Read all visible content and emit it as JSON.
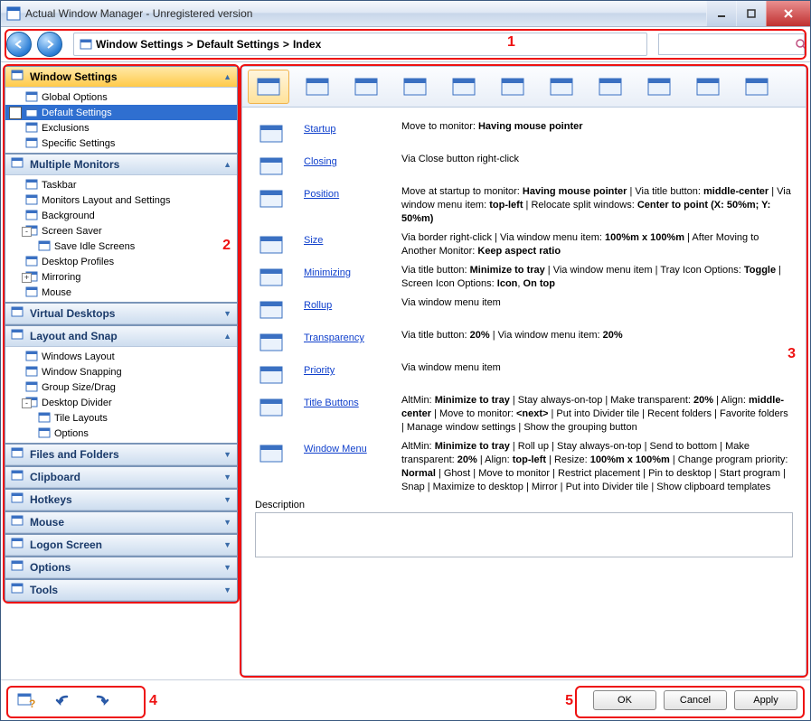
{
  "title": "Actual Window Manager - Unregistered version",
  "breadcrumb": [
    "Window Settings",
    "Default Settings",
    "Index"
  ],
  "search": {
    "placeholder": ""
  },
  "annotations": {
    "n1": "1",
    "n2": "2",
    "n3": "3",
    "n4": "4",
    "n5": "5"
  },
  "side": [
    {
      "hdr": "Window Settings",
      "sel": true,
      "open": true,
      "items": [
        {
          "t": "Global Options"
        },
        {
          "t": "Default Settings",
          "sel": true,
          "check": true
        },
        {
          "t": "Exclusions"
        },
        {
          "t": "Specific Settings"
        }
      ]
    },
    {
      "hdr": "Multiple Monitors",
      "open": true,
      "items": [
        {
          "t": "Taskbar"
        },
        {
          "t": "Monitors Layout and Settings"
        },
        {
          "t": "Background"
        },
        {
          "t": "Screen Saver",
          "exp": "-"
        },
        {
          "t": "Save Idle Screens",
          "ind": 1
        },
        {
          "t": "Desktop Profiles"
        },
        {
          "t": "Mirroring",
          "exp": "+"
        },
        {
          "t": "Mouse"
        }
      ]
    },
    {
      "hdr": "Virtual Desktops",
      "open": false
    },
    {
      "hdr": "Layout and Snap",
      "open": true,
      "items": [
        {
          "t": "Windows Layout"
        },
        {
          "t": "Window Snapping"
        },
        {
          "t": "Group Size/Drag"
        },
        {
          "t": "Desktop Divider",
          "exp": "-"
        },
        {
          "t": "Tile Layouts",
          "ind": 1
        },
        {
          "t": "Options",
          "ind": 1
        }
      ]
    },
    {
      "hdr": "Files and Folders",
      "open": false
    },
    {
      "hdr": "Clipboard",
      "open": false
    },
    {
      "hdr": "Hotkeys",
      "open": false
    },
    {
      "hdr": "Mouse",
      "open": false
    },
    {
      "hdr": "Logon Screen",
      "open": false
    },
    {
      "hdr": "Options",
      "open": false
    },
    {
      "hdr": "Tools",
      "open": false
    }
  ],
  "toolbar_icons": [
    "index",
    "startup",
    "closing",
    "position",
    "size",
    "minimizing",
    "rollup",
    "transparency",
    "priority",
    "title-buttons",
    "window-menu"
  ],
  "rows": [
    {
      "k": "startup",
      "lbl": "Startup",
      "desc": "Move to monitor: <b>Having mouse pointer</b>"
    },
    {
      "k": "closing",
      "lbl": "Closing",
      "desc": "Via Close button right-click"
    },
    {
      "k": "position",
      "lbl": "Position",
      "desc": "Move at startup to monitor: <b>Having mouse pointer</b> | Via title button: <b>middle-center</b> | Via window menu item: <b>top-left</b> | Relocate split windows: <b>Center to point (X: 50%m; Y: 50%m)</b>"
    },
    {
      "k": "size",
      "lbl": "Size",
      "desc": "Via border right-click | Via window menu item: <b>100%m x 100%m</b> | After Moving to Another Monitor: <b>Keep aspect ratio</b>"
    },
    {
      "k": "minimizing",
      "lbl": "Minimizing",
      "desc": "Via title button: <b>Minimize to tray</b> | Via window menu item | Tray Icon Options: <b>Toggle</b> | Screen Icon Options: <b>Icon</b>, <b>On top</b>"
    },
    {
      "k": "rollup",
      "lbl": "Rollup",
      "desc": "Via window menu item"
    },
    {
      "k": "transparency",
      "lbl": "Transparency",
      "desc": "Via title button: <b>20%</b> | Via window menu item: <b>20%</b>"
    },
    {
      "k": "priority",
      "lbl": "Priority",
      "desc": "Via window menu item"
    },
    {
      "k": "titlebuttons",
      "lbl": "Title Buttons",
      "desc": "AltMin: <b>Minimize to tray</b> | Stay always-on-top | Make transparent: <b>20%</b> | Align: <b>middle-center</b> | Move to monitor: <b>&lt;next&gt;</b> | Put into Divider tile | Recent folders | Favorite folders | Manage window settings | Show the grouping button"
    },
    {
      "k": "windowmenu",
      "lbl": "Window Menu",
      "desc": "AltMin: <b>Minimize to tray</b> | Roll up | Stay always-on-top | Send to bottom | Make transparent: <b>20%</b> | Align: <b>top-left</b> | Resize: <b>100%m x 100%m</b> | Change program priority: <b>Normal</b> | Ghost | Move to monitor | Restrict placement | Pin to desktop | Start program | Snap | Maximize to desktop | Mirror | Put into Divider tile | Show clipboard templates"
    }
  ],
  "desc_label": "Description",
  "buttons": {
    "ok": "OK",
    "cancel": "Cancel",
    "apply": "Apply"
  }
}
